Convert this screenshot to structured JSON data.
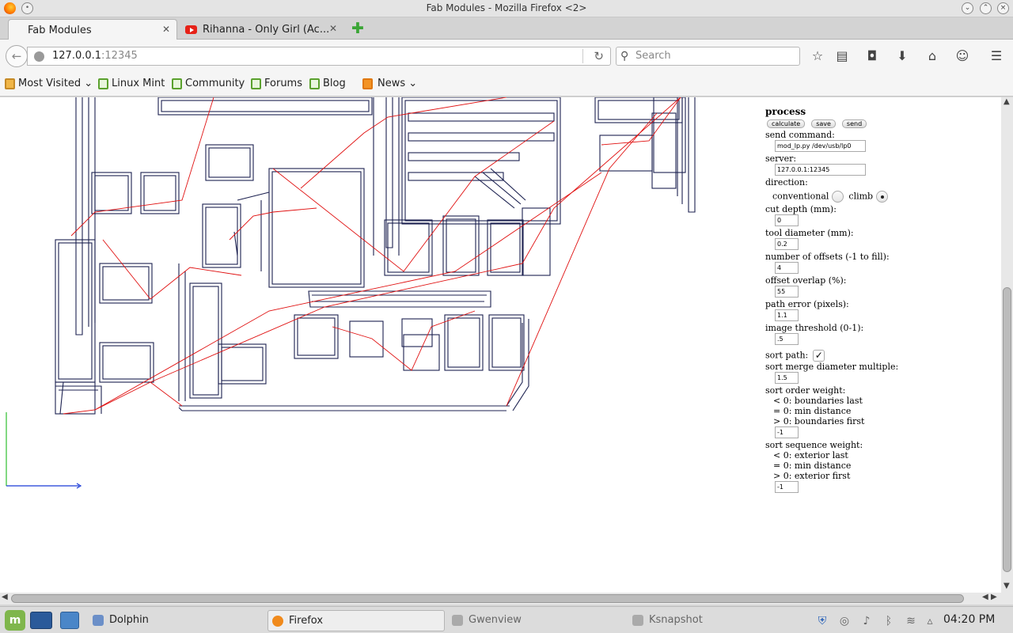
{
  "window": {
    "title": "Fab Modules - Mozilla Firefox <2>"
  },
  "tabs": [
    {
      "label": "Fab Modules",
      "active": true
    },
    {
      "label": "Rihanna - Only Girl (Ac...",
      "active": false
    }
  ],
  "nav": {
    "url_host": "127.0.0.1",
    "url_port": ":12345",
    "search_placeholder": "Search"
  },
  "bookmarks": [
    {
      "label": "Most Visited",
      "icon": "folder-icon"
    },
    {
      "label": "Linux Mint",
      "icon": "mint-icon"
    },
    {
      "label": "Community",
      "icon": "mint-icon"
    },
    {
      "label": "Forums",
      "icon": "mint-icon"
    },
    {
      "label": "Blog",
      "icon": "mint-icon"
    },
    {
      "label": "News",
      "icon": "rss-icon"
    }
  ],
  "panel": {
    "title": "process",
    "buttons": {
      "calculate": "calculate",
      "save": "save",
      "send": "send"
    },
    "send_command_label": "send command:",
    "send_command_value": "mod_lp.py /dev/usb/lp0",
    "server_label": "server:",
    "server_value": "127.0.0.1:12345",
    "direction_label": "direction:",
    "direction_conventional": "conventional",
    "direction_climb": "climb",
    "direction_selected": "climb",
    "cut_depth_label": "cut depth (mm):",
    "cut_depth_value": "0",
    "tool_diameter_label": "tool diameter (mm):",
    "tool_diameter_value": "0.2",
    "offsets_label": "number of offsets (-1 to fill):",
    "offsets_value": "4",
    "overlap_label": "offset overlap (%):",
    "overlap_value": "55",
    "path_error_label": "path error (pixels):",
    "path_error_value": "1.1",
    "threshold_label": "image threshold (0-1):",
    "threshold_value": ".5",
    "sort_path_label": "sort path:",
    "sort_path_checked": true,
    "merge_label": "sort merge diameter multiple:",
    "merge_value": "1.5",
    "order_weight_label": "sort order weight:",
    "order_lines": [
      "< 0: boundaries last",
      "= 0: min distance",
      "> 0: boundaries first"
    ],
    "order_value": "-1",
    "sequence_weight_label": "sort sequence weight:",
    "sequence_lines": [
      "< 0: exterior last",
      "= 0: min distance",
      "> 0: exterior first"
    ],
    "sequence_value": "-1"
  },
  "taskbar": {
    "tasks": [
      {
        "label": "Dolphin",
        "active": false
      },
      {
        "label": "Firefox",
        "active": true
      },
      {
        "label": "Gwenview",
        "active": false
      },
      {
        "label": "Ksnapshot",
        "active": false
      }
    ],
    "clock": "04:20 PM"
  },
  "colors": {
    "toolpath": "#1c2150",
    "jump": "#e01010",
    "axis_x": "#1a3ad8",
    "axis_y": "#2fbf2f",
    "accent_green": "#5ba12e"
  }
}
